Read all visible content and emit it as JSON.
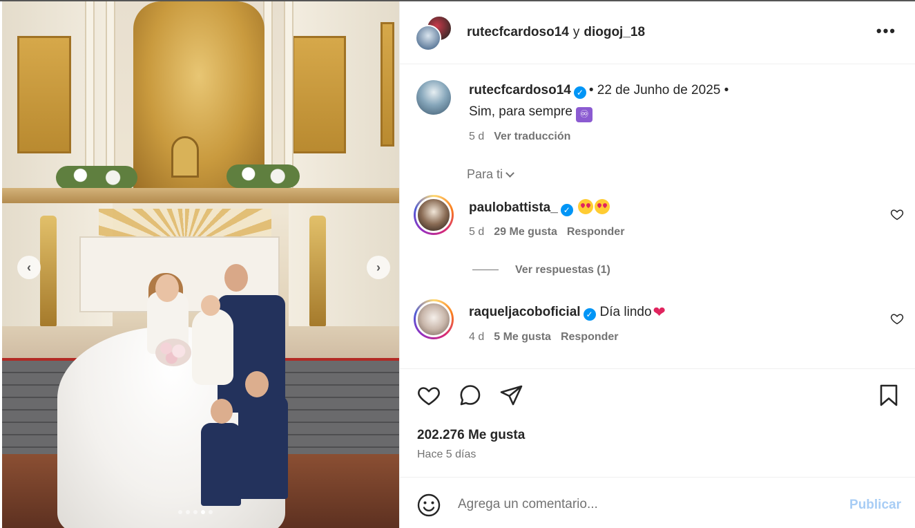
{
  "post": {
    "header": {
      "author": "rutecfcardoso14",
      "conjunction": "y",
      "coauthor": "diogoj_18",
      "more_icon": "more-horizontal-icon"
    },
    "caption": {
      "username": "rutecfcardoso14",
      "verified": true,
      "meta": "• 22 de Junho de 2025 •",
      "text": "Sim, para sempre",
      "emoji": "♾",
      "age": "5 d",
      "translate_label": "Ver traducción"
    },
    "filter_label": "Para ti",
    "comments": [
      {
        "username": "paulobattista_",
        "verified": true,
        "text": "",
        "emoji": "star-struck-emoji x2",
        "age": "5 d",
        "likes": "29 Me gusta",
        "reply_label": "Responder"
      },
      {
        "username": "raqueljacoboficial",
        "verified": true,
        "text": "Día lindo",
        "emoji": "❤",
        "age": "4 d",
        "likes": "5 Me gusta",
        "reply_label": "Responder"
      }
    ],
    "replies_label": "Ver respuestas (1)",
    "likes_count": "202.276 Me gusta",
    "posted_ago": "Hace 5 días",
    "composer": {
      "placeholder": "Agrega un comentario...",
      "publish_label": "Publicar"
    },
    "carousel": {
      "prev": "‹",
      "next": "›",
      "slides": 5,
      "active_slide": 4
    },
    "colors": {
      "verified": "#0095f6",
      "publish_disabled": "#a8cdf5",
      "secondary_text": "#737373"
    }
  }
}
